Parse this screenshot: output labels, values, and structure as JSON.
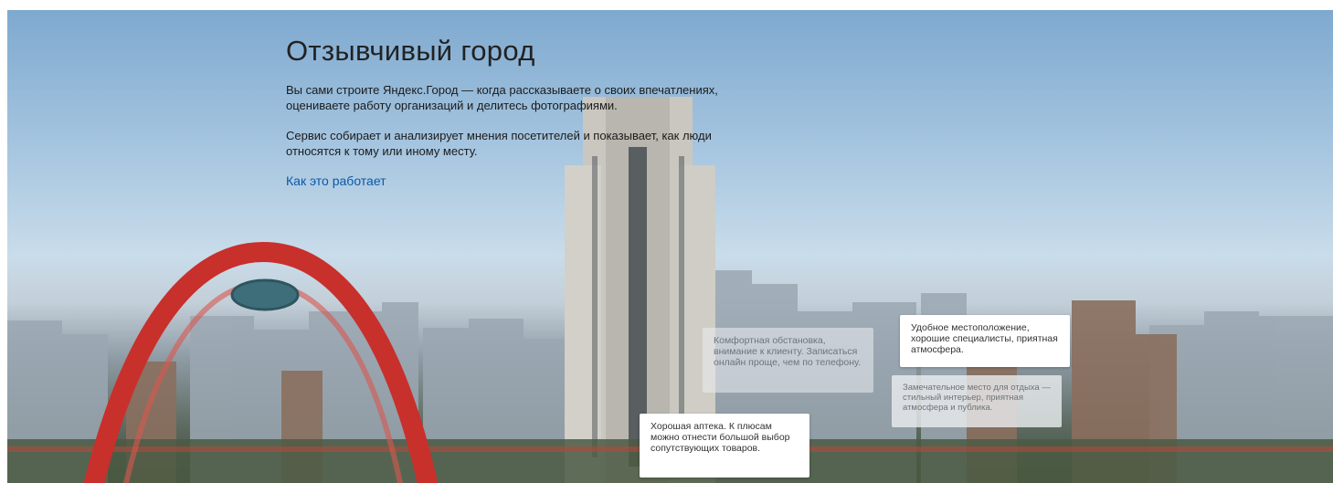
{
  "hero": {
    "title": "Отзывчивый город",
    "paragraph1": "Вы сами строите Яндекс.Город — когда рассказываете о своих впечатлениях, оцениваете работу организаций и делитесь фотографиями.",
    "paragraph2": "Сервис собирает и анализирует мнения посетителей и показывает, как люди относятся к тому или иному месту.",
    "link": "Как это работает"
  },
  "review_cards": [
    {
      "text": "Комфортная обстановка, внимание к клиенту. Записаться онлайн проще, чем по телефону."
    },
    {
      "text": "Удобное местоположение, хорошие специалисты, приятная атмосфера."
    },
    {
      "text": "Замечательное место для отдыха — стильный интерьер, приятная атмосфера и публика."
    },
    {
      "text": "Хорошая аптека. К плюсам можно отнести большой выбор сопутствующих товаров."
    }
  ],
  "colors": {
    "link": "#0b58a8",
    "bridge": "#c8302c",
    "sky": "#a7c6e0"
  }
}
